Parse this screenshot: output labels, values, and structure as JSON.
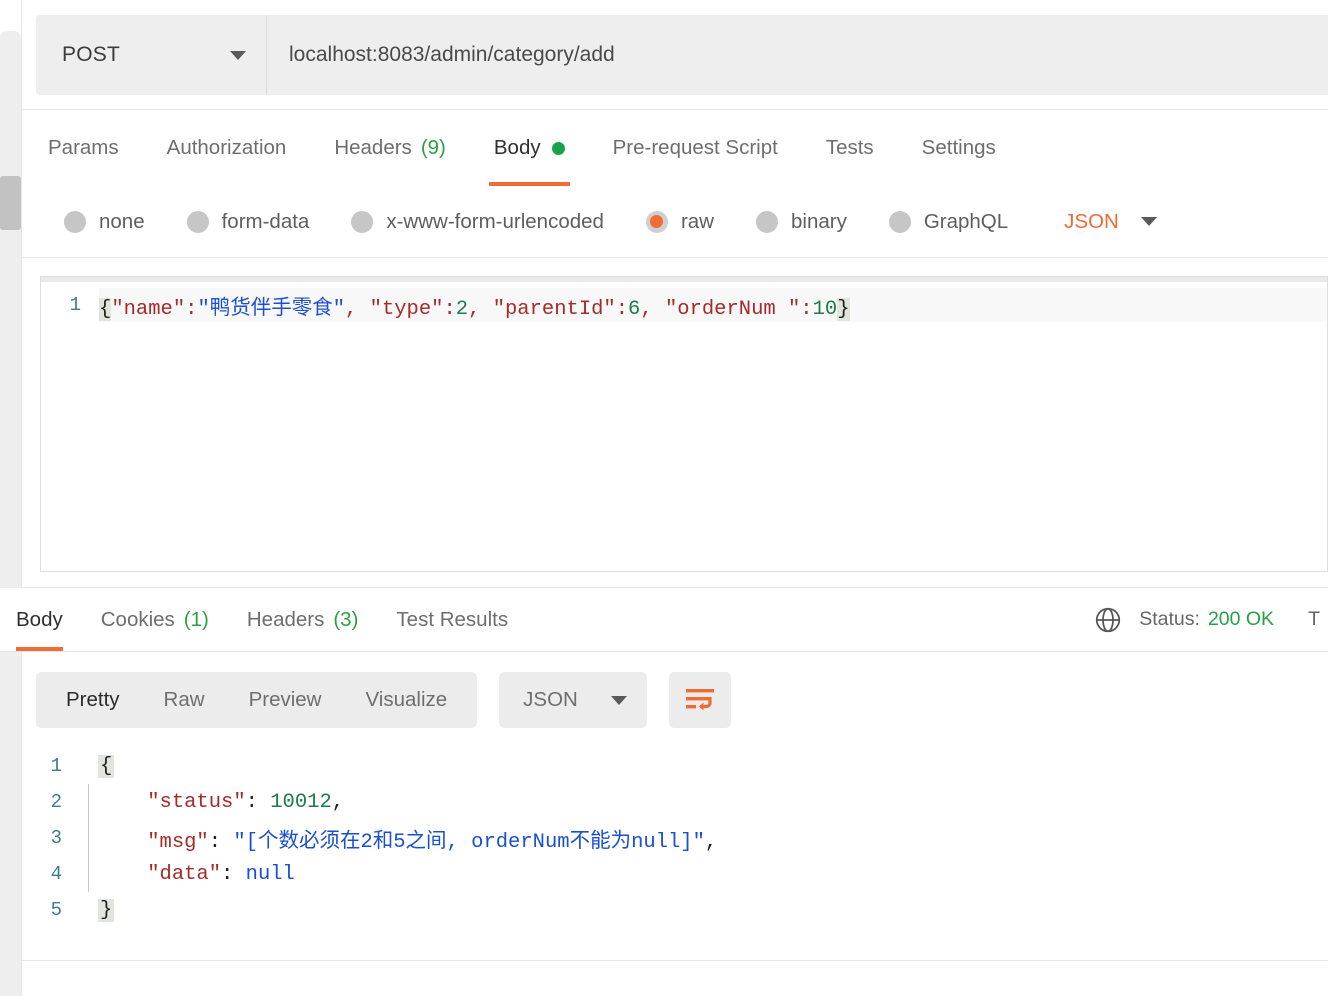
{
  "request": {
    "method": "POST",
    "url": "localhost:8083/admin/category/add",
    "tabs": [
      {
        "label": "Params",
        "count": null,
        "dot": false,
        "active": false
      },
      {
        "label": "Authorization",
        "count": null,
        "dot": false,
        "active": false
      },
      {
        "label": "Headers",
        "count": "(9)",
        "dot": false,
        "active": false
      },
      {
        "label": "Body",
        "count": null,
        "dot": true,
        "active": true
      },
      {
        "label": "Pre-request Script",
        "count": null,
        "dot": false,
        "active": false
      },
      {
        "label": "Tests",
        "count": null,
        "dot": false,
        "active": false
      },
      {
        "label": "Settings",
        "count": null,
        "dot": false,
        "active": false
      }
    ],
    "body_modes": [
      {
        "label": "none",
        "selected": false
      },
      {
        "label": "form-data",
        "selected": false
      },
      {
        "label": "x-www-form-urlencoded",
        "selected": false
      },
      {
        "label": "raw",
        "selected": true
      },
      {
        "label": "binary",
        "selected": false
      },
      {
        "label": "GraphQL",
        "selected": false
      }
    ],
    "language": "JSON",
    "body_line_number": "1",
    "body_tokens": [
      {
        "text": "{",
        "type": "brace-hl"
      },
      {
        "text": "\"name\"",
        "type": "key"
      },
      {
        "text": ":",
        "type": "punct"
      },
      {
        "text": "\"鸭货伴手零食\"",
        "type": "str"
      },
      {
        "text": ", ",
        "type": "punct"
      },
      {
        "text": "\"type\"",
        "type": "key"
      },
      {
        "text": ":",
        "type": "punct"
      },
      {
        "text": "2",
        "type": "num"
      },
      {
        "text": ", ",
        "type": "punct"
      },
      {
        "text": "\"parentId\"",
        "type": "key"
      },
      {
        "text": ":",
        "type": "punct"
      },
      {
        "text": "6",
        "type": "num"
      },
      {
        "text": ", ",
        "type": "punct"
      },
      {
        "text": "\"orderNum \"",
        "type": "key"
      },
      {
        "text": ":",
        "type": "punct"
      },
      {
        "text": "10",
        "type": "num"
      },
      {
        "text": "}",
        "type": "brace-hl"
      }
    ],
    "body_raw": "{\"name\":\"鸭货伴手零食\", \"type\":2, \"parentId\":6, \"orderNum \":10}"
  },
  "response": {
    "tabs": [
      {
        "label": "Body",
        "count": null,
        "active": true
      },
      {
        "label": "Cookies",
        "count": "(1)",
        "active": false
      },
      {
        "label": "Headers",
        "count": "(3)",
        "active": false
      },
      {
        "label": "Test Results",
        "count": null,
        "active": false
      }
    ],
    "status_label": "Status:",
    "status_value": "200 OK",
    "time_truncated": "T",
    "view_tabs": [
      {
        "label": "Pretty",
        "active": true
      },
      {
        "label": "Raw",
        "active": false
      },
      {
        "label": "Preview",
        "active": false
      },
      {
        "label": "Visualize",
        "active": false
      }
    ],
    "format": "JSON",
    "wrap_icon": "word-wrap-icon",
    "globe_icon": "globe-icon",
    "body_lines": [
      {
        "num": "1",
        "tokens": [
          {
            "text": "{",
            "type": "brace-hl"
          }
        ]
      },
      {
        "num": "2",
        "tokens": [
          {
            "text": "    ",
            "type": "indent"
          },
          {
            "text": "\"status\"",
            "type": "key"
          },
          {
            "text": ": ",
            "type": "plain"
          },
          {
            "text": "10012",
            "type": "num"
          },
          {
            "text": ",",
            "type": "plain"
          }
        ]
      },
      {
        "num": "3",
        "tokens": [
          {
            "text": "    ",
            "type": "indent"
          },
          {
            "text": "\"msg\"",
            "type": "key"
          },
          {
            "text": ": ",
            "type": "plain"
          },
          {
            "text": "\"[个数必须在2和5之间, orderNum不能为null]\"",
            "type": "str"
          },
          {
            "text": ",",
            "type": "plain"
          }
        ]
      },
      {
        "num": "4",
        "tokens": [
          {
            "text": "    ",
            "type": "indent"
          },
          {
            "text": "\"data\"",
            "type": "key"
          },
          {
            "text": ": ",
            "type": "plain"
          },
          {
            "text": "null",
            "type": "bool"
          }
        ]
      },
      {
        "num": "5",
        "tokens": [
          {
            "text": "}",
            "type": "brace-hl"
          }
        ]
      }
    ],
    "body_raw": "{\n    \"status\": 10012,\n    \"msg\": \"[个数必须在2和5之间, orderNum不能为null]\",\n    \"data\": null\n}"
  },
  "colors": {
    "accent": "#ef6c35",
    "success": "#24a148",
    "count_green": "#2f9e44",
    "key": "#a52a2a",
    "string": "#1a4fcf",
    "number": "#1f7a4d",
    "gutter": "#3f7d8c"
  }
}
